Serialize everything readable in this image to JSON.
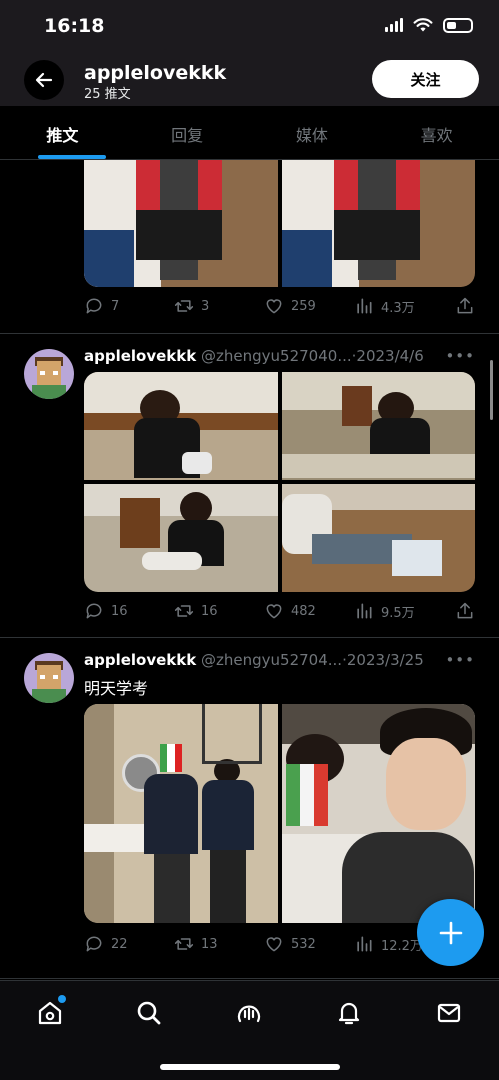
{
  "status_bar": {
    "time": "16:18"
  },
  "header": {
    "username": "applelovekkk",
    "tweet_count": "25 推文",
    "follow_label": "关注"
  },
  "tabs": [
    {
      "label": "推文",
      "active": true
    },
    {
      "label": "回复",
      "active": false
    },
    {
      "label": "媒体",
      "active": false
    },
    {
      "label": "喜欢",
      "active": false
    }
  ],
  "posts": [
    {
      "stats": {
        "replies": "7",
        "retweets": "3",
        "likes": "259",
        "views": "4.3万"
      }
    },
    {
      "username": "applelovekkk",
      "handle": "@zhengyu527040...",
      "separator": "·",
      "date": "2023/4/6",
      "stats": {
        "replies": "16",
        "retweets": "16",
        "likes": "482",
        "views": "9.5万"
      }
    },
    {
      "username": "applelovekkk",
      "handle": "@zhengyu52704...",
      "separator": "·",
      "date": "2023/3/25",
      "text": "明天学考",
      "stats": {
        "replies": "22",
        "retweets": "13",
        "likes": "532",
        "views": "12.2万"
      }
    }
  ],
  "more_label": "•••",
  "colors": {
    "accent": "#1d9bf0",
    "background": "#000000",
    "muted": "#71767b",
    "header_bg": "#1c1a1e"
  },
  "icons": [
    "back-arrow-icon",
    "wifi-icon",
    "battery-icon",
    "reply-icon",
    "retweet-icon",
    "like-icon",
    "views-icon",
    "share-icon",
    "compose-plus-icon",
    "home-icon",
    "search-icon",
    "spaces-icon",
    "notifications-icon",
    "messages-icon"
  ]
}
